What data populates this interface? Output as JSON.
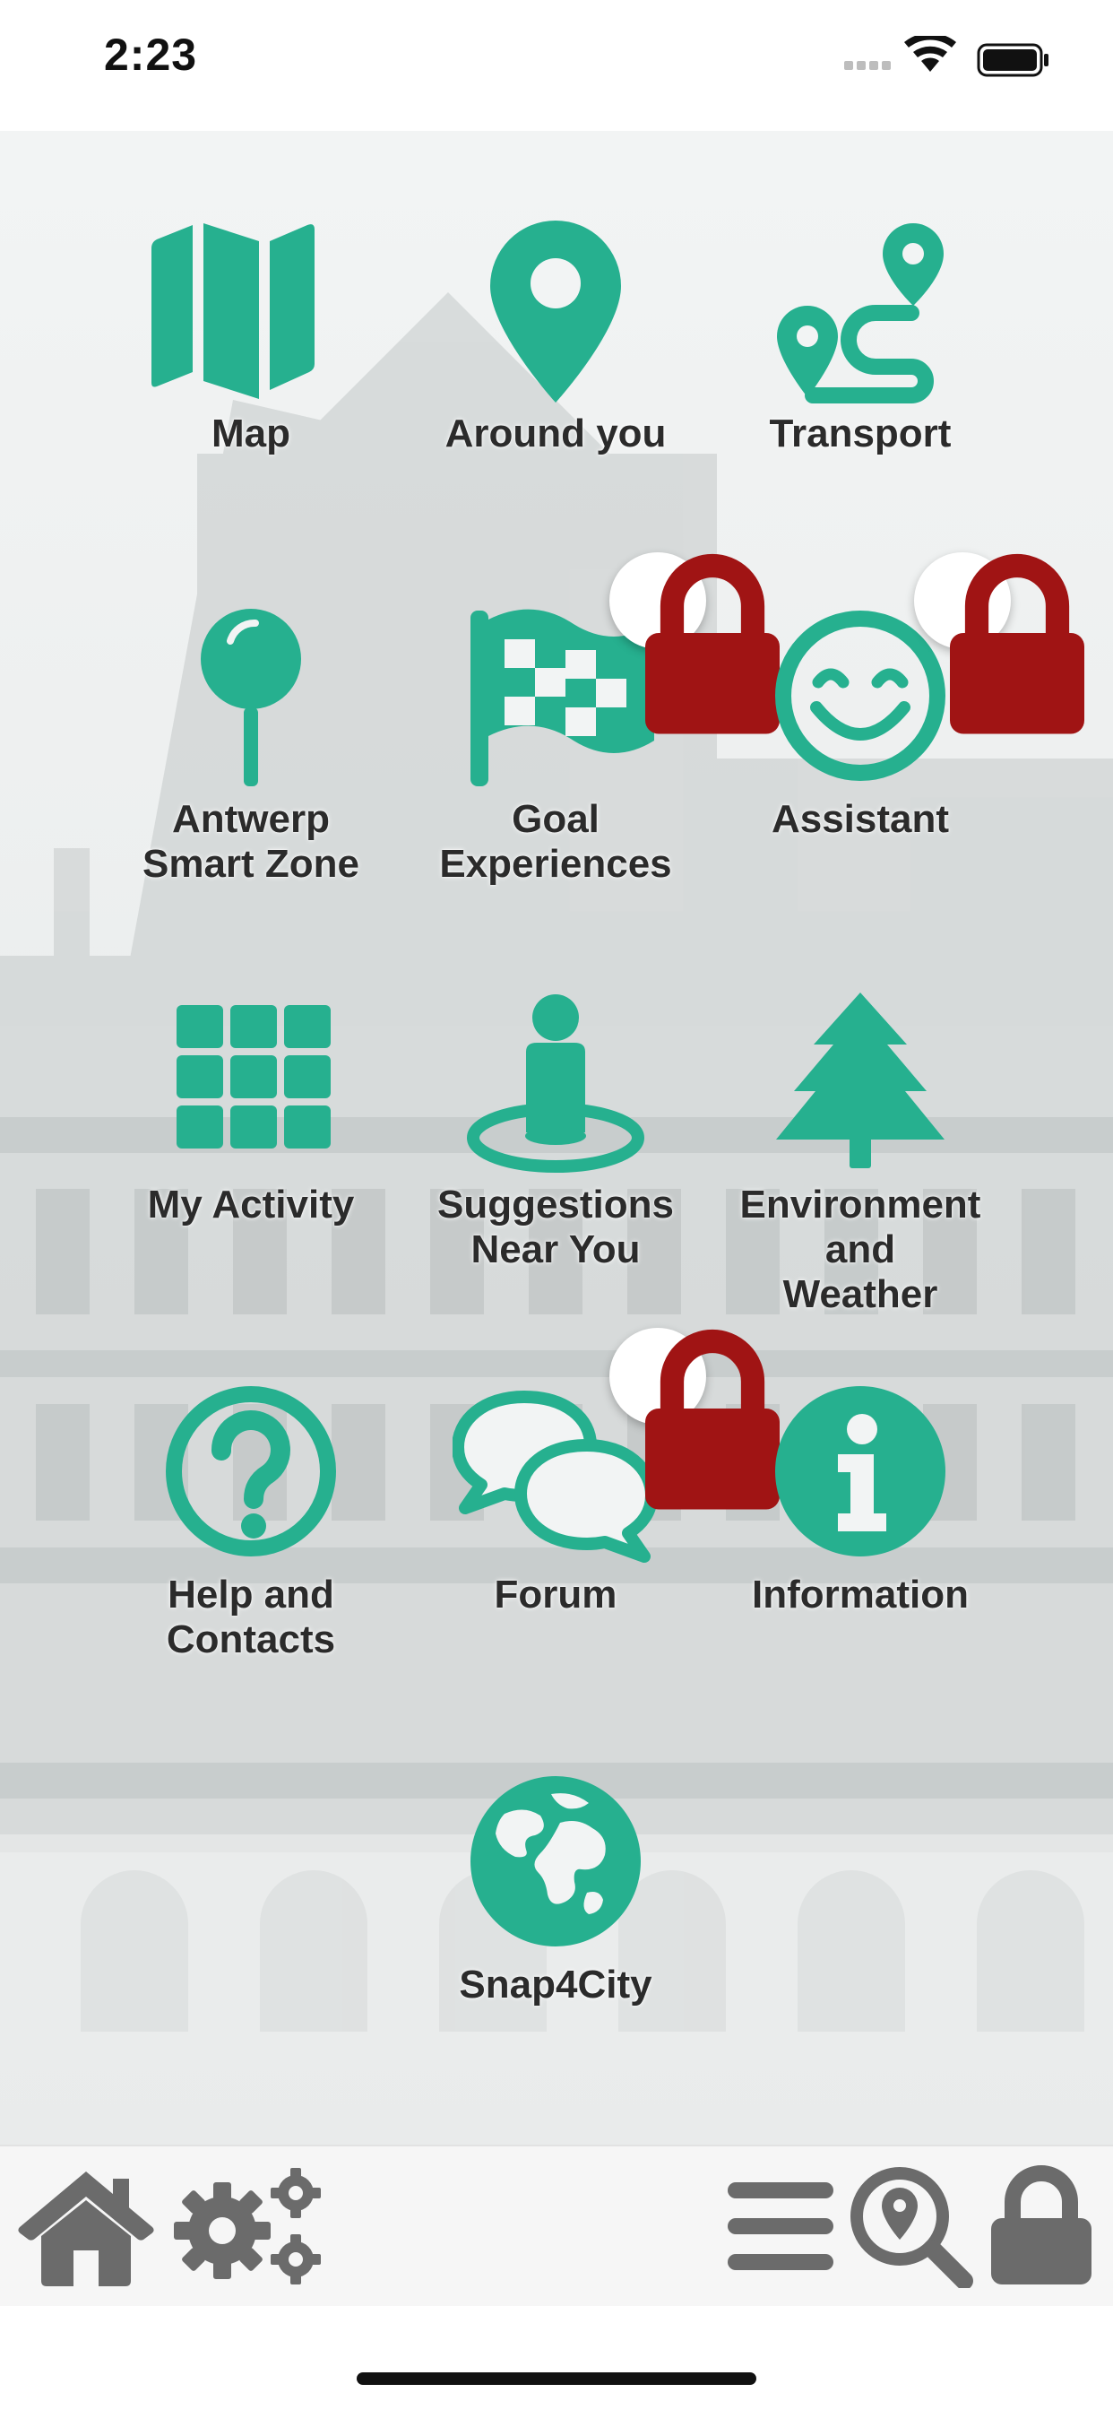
{
  "status_bar": {
    "time": "2:23"
  },
  "colors": {
    "accent": "#26b08f",
    "lock": "#a01414",
    "toolbar_icon": "#6b6b6b"
  },
  "tiles": [
    {
      "id": "map",
      "label": "Map",
      "icon": "folded-map-icon",
      "locked": false
    },
    {
      "id": "around",
      "label": "Around you",
      "icon": "location-pin-icon",
      "locked": false
    },
    {
      "id": "transport",
      "label": "Transport",
      "icon": "route-icon",
      "locked": false
    },
    {
      "id": "antwerp",
      "label": "Antwerp\nSmart Zone",
      "icon": "pushpin-icon",
      "locked": false
    },
    {
      "id": "goal",
      "label": "Goal\nExperiences",
      "icon": "checkered-flag-icon",
      "locked": true
    },
    {
      "id": "assistant",
      "label": "Assistant",
      "icon": "smiley-icon",
      "locked": true
    },
    {
      "id": "activity",
      "label": "My Activity",
      "icon": "grid-icon",
      "locked": false
    },
    {
      "id": "suggestions",
      "label": "Suggestions\nNear You",
      "icon": "person-on-spot-icon",
      "locked": false
    },
    {
      "id": "environment",
      "label": "Environment\nand\nWeather",
      "icon": "tree-icon",
      "locked": false
    },
    {
      "id": "help",
      "label": "Help and\nContacts",
      "icon": "question-circle-icon",
      "locked": false
    },
    {
      "id": "forum",
      "label": "Forum",
      "icon": "speech-bubbles-icon",
      "locked": true
    },
    {
      "id": "information",
      "label": "Information",
      "icon": "info-circle-icon",
      "locked": false
    },
    {
      "id": "snap4city",
      "label": "Snap4City",
      "icon": "globe-icon",
      "locked": false
    }
  ],
  "toolbar": {
    "items": [
      "home-icon",
      "gears-icon",
      "menu-icon",
      "search-location-icon",
      "lock-icon"
    ]
  }
}
